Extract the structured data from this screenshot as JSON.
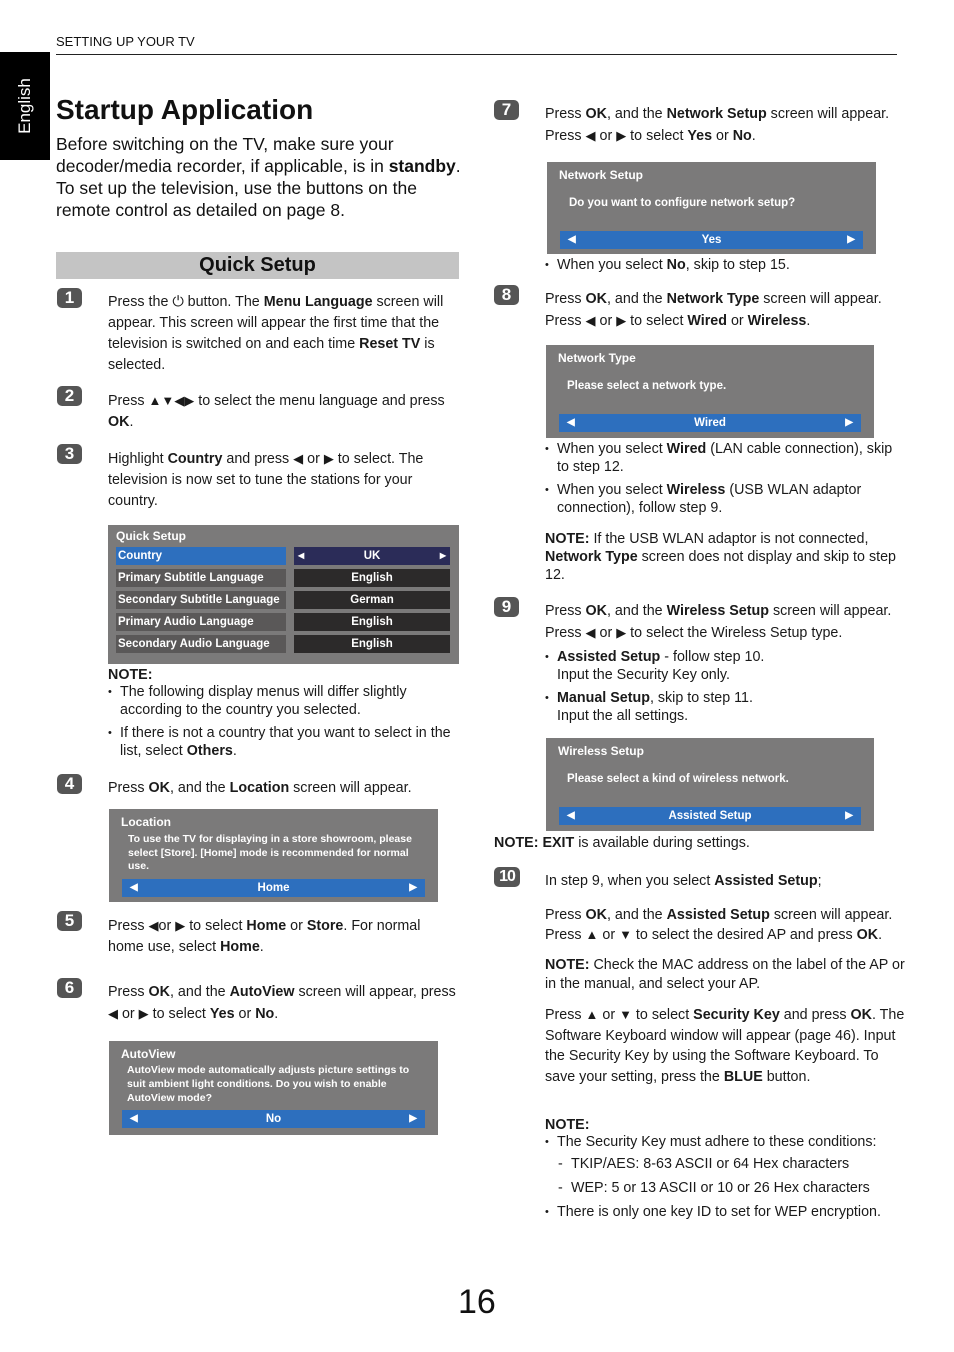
{
  "header": {
    "section": "SETTING UP YOUR TV",
    "language_tab": "English"
  },
  "title": "Startup Application",
  "intro": {
    "part1": "Before switching on the TV, make sure your decoder/media recorder, if applicable, is in ",
    "bold": "standby",
    "part2": ". To set up the television, use the buttons on the remote control as detailed on page 8."
  },
  "quick_setup_heading": "Quick Setup",
  "steps": {
    "s1": {
      "num": "1",
      "t1": "Press the ",
      "power": "⏻",
      "t2": " button. The ",
      "b1": "Menu Language",
      "t3": " screen will appear. This screen will appear the first time that the television is switched on and each time ",
      "b2": "Reset TV",
      "t4": " is selected."
    },
    "s2": {
      "num": "2",
      "t1": "Press ",
      "arrows": "▲▼◀▶",
      "t2": " to select the menu language and press ",
      "b1": "OK",
      "t3": "."
    },
    "s3": {
      "num": "3",
      "t1": "Highlight ",
      "b1": "Country",
      "t2": " and press ",
      "left": "◀",
      "t3": " or ",
      "right": "▶",
      "t4": " to select. The television is now set to tune the stations for your country."
    },
    "s4": {
      "num": "4",
      "t1": "Press ",
      "b1": "OK",
      "t2": ", and the ",
      "b2": "Location",
      "t3": " screen will appear."
    },
    "s5": {
      "num": "5",
      "t1": "Press ",
      "left": "◀",
      "t2": "or ",
      "right": "▶",
      "t3": " to select ",
      "b1": "Home",
      "t4": " or ",
      "b2": "Store",
      "t5": ". For normal home use, select ",
      "b3": "Home",
      "t6": "."
    },
    "s6": {
      "num": "6",
      "t1": "Press ",
      "b1": "OK",
      "t2": ", and the ",
      "b2": "AutoView",
      "t3": " screen will appear, press ",
      "left": "◀",
      "t4": " or ",
      "right": "▶",
      "t5": " to select ",
      "b3": "Yes",
      "t6": " or ",
      "b4": "No",
      "t7": "."
    },
    "s7": {
      "num": "7",
      "t1": "Press ",
      "b1": "OK",
      "t2": ", and the ",
      "b2": "Network Setup",
      "t3": " screen will appear. Press ",
      "left": "◀",
      "t4": " or ",
      "right": "▶",
      "t5": " to select ",
      "b3": "Yes",
      "t6": " or ",
      "b4": "No",
      "t7": "."
    },
    "s8": {
      "num": "8",
      "t1": "Press ",
      "b1": "OK",
      "t2": ", and the ",
      "b2": "Network Type",
      "t3": " screen will appear. Press ",
      "left": "◀",
      "t4": " or ",
      "right": "▶",
      "t5": " to select ",
      "b3": "Wired",
      "t6": " or ",
      "b4": "Wireless",
      "t7": "."
    },
    "s9": {
      "num": "9",
      "t1": "Press ",
      "b1": "OK",
      "t2": ", and the ",
      "b2": "Wireless Setup",
      "t3": " screen will appear. Press ",
      "left": "◀",
      "t4": " or ",
      "right": "▶",
      "t5": " to select the Wireless Setup type."
    },
    "s10": {
      "num": "10",
      "t1": "In step 9, when you select ",
      "b1": "Assisted Setup",
      "t2": ";"
    }
  },
  "quick_setup_screen": {
    "title": "Quick Setup",
    "arrow_left": "◀",
    "arrow_right": "▶",
    "rows": [
      {
        "label": "Country",
        "value": "UK",
        "active": true
      },
      {
        "label": "Primary Subtitle Language",
        "value": "English"
      },
      {
        "label": "Secondary Subtitle Language",
        "value": "German"
      },
      {
        "label": "Primary Audio Language",
        "value": "English"
      },
      {
        "label": "Secondary Audio Language",
        "value": "English"
      }
    ]
  },
  "note_country": {
    "heading": "NOTE:",
    "b1": "The following display menus will differ slightly according to the country you selected.",
    "b2_pre": "If there is not a country that you want to select in the list, select ",
    "b2_bold": "Others",
    "b2_post": "."
  },
  "location_screen": {
    "title": "Location",
    "message": "To use the TV for displaying in a store showroom, please select [Store].  [Home] mode is recommended for normal use.",
    "selection": "Home",
    "arrow_left": "◀",
    "arrow_right": "▶"
  },
  "autoview_screen": {
    "title": "AutoView",
    "message": "AutoView mode automatically adjusts picture settings to suit ambient light conditions. Do you wish to enable AutoView mode?",
    "selection": "No",
    "arrow_left": "◀",
    "arrow_right": "▶"
  },
  "network_setup_screen": {
    "title": "Network Setup",
    "message": "Do you want to configure network setup?",
    "selection": "Yes",
    "arrow_left": "◀",
    "arrow_right": "▶"
  },
  "step7_bullet": {
    "pre": "When you select ",
    "bold": "No",
    "post": ", skip to step 15."
  },
  "network_type_screen": {
    "title": "Network Type",
    "message": "Please select a network type.",
    "selection": "Wired",
    "arrow_left": "◀",
    "arrow_right": "▶"
  },
  "step8_bullets": [
    {
      "pre": "When you select ",
      "bold": "Wired",
      "post": " (LAN cable connection), skip to step 12."
    },
    {
      "pre": "When you select ",
      "bold": "Wireless",
      "post": " (USB WLAN adaptor connection), follow step 9."
    }
  ],
  "step8_note": {
    "head": "NOTE:",
    "t1": " If the USB WLAN adaptor is not connected, ",
    "b1": "Network Type",
    "t2": " screen does not display and skip to step 12."
  },
  "step9_bullets": [
    {
      "bold": "Assisted Setup",
      "post": " -  follow step 10.",
      "line2": "Input the Security Key only."
    },
    {
      "bold": "Manual Setup",
      "post": ", skip to step 11.",
      "line2": "Input the all settings."
    }
  ],
  "wireless_setup_screen": {
    "title": "Wireless Setup",
    "message": "Please select a kind of wireless network.",
    "selection": "Assisted Setup",
    "arrow_left": "◀",
    "arrow_right": "▶"
  },
  "exit_note": {
    "head": "NOTE: EXIT",
    "post": " is available during settings."
  },
  "step10_body": {
    "p1": {
      "t1": "Press ",
      "b1": "OK",
      "t2": ", and the ",
      "b2": "Assisted Setup",
      "t3": " screen will appear. Press ",
      "up": "▲",
      "t4": " or ",
      "down": "▼",
      "t5": " to select the desired AP and press ",
      "b3": "OK",
      "t6": "."
    },
    "p2": {
      "head": "NOTE:",
      "text": " Check the MAC address on the label of the AP or in the manual, and select your AP."
    },
    "p3": {
      "t1": "Press ",
      "up": "▲",
      "t2": " or ",
      "down": "▼",
      "t3": " to select ",
      "b1": "Security Key",
      "t4": " and press ",
      "b2": "OK",
      "t5": ". The Software Keyboard window will appear (page 46). Input the Security Key by using the Software Keyboard. To save your setting, press the ",
      "b3": "BLUE",
      "t6": " button."
    },
    "note_head": "NOTE:",
    "bullet1": "The Security Key must adhere to these conditions:",
    "dashes": [
      "TKIP/AES: 8-63 ASCII or 64 Hex characters",
      "WEP: 5 or 13 ASCII or 10 or 26 Hex characters"
    ],
    "bullet2": "There is only one key ID to set for WEP encryption."
  },
  "page_number": "16"
}
